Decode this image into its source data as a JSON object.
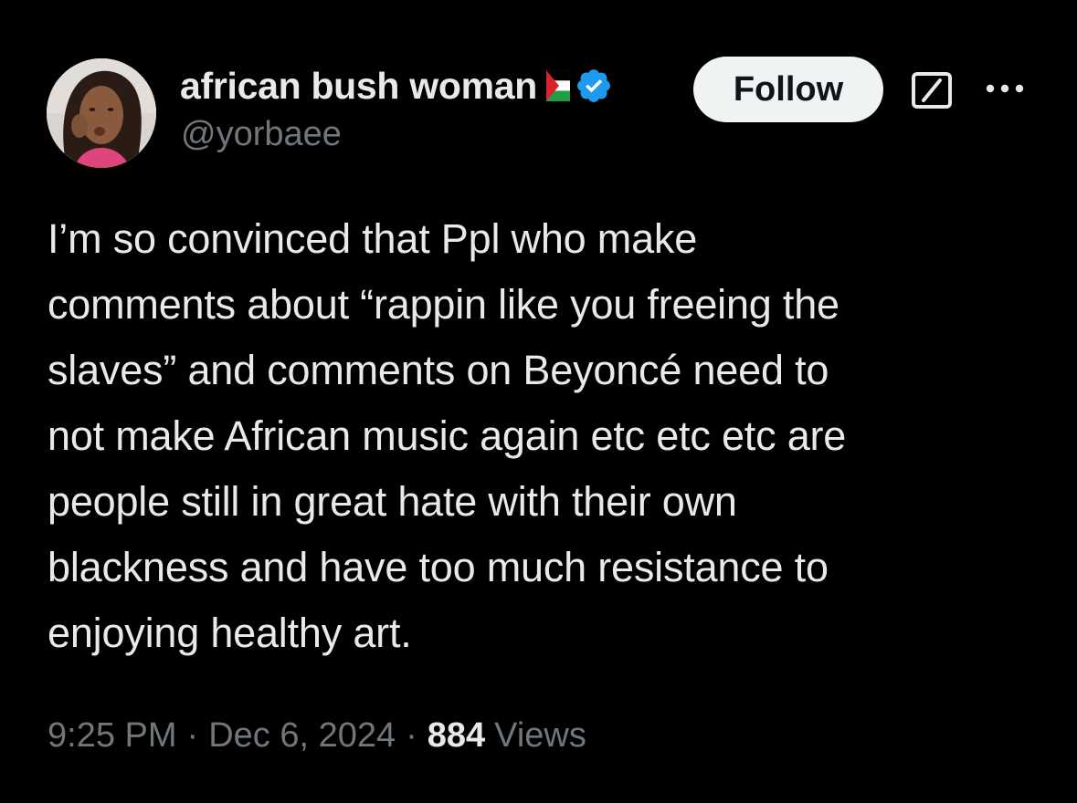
{
  "user": {
    "display_name": "african bush woman",
    "handle": "@yorbaee",
    "flag_icon": "palestine-flag-icon",
    "verified_icon": "verified-badge-icon",
    "avatar_icon": "profile-avatar"
  },
  "actions": {
    "follow_label": "Follow",
    "grok_icon": "grok-icon",
    "more_icon": "more-options-icon"
  },
  "tweet": {
    "text": "I’m so convinced that Ppl who make\ncomments about “rappin like you freeing the\nslaves” and comments on Beyoncé need to\nnot make African music again etc etc etc are\npeople still in great hate with their own\nblackness and have too much resistance to\nenjoying healthy art."
  },
  "meta": {
    "time": "9:25 PM",
    "separator": "·",
    "date": "Dec 6, 2024",
    "views_count": "884",
    "views_label": "Views"
  },
  "colors": {
    "background": "#000000",
    "primary_text": "#e7e9ea",
    "secondary_text": "#71767b",
    "verified_blue": "#1d9bf0",
    "follow_bg": "#eff3f4"
  }
}
